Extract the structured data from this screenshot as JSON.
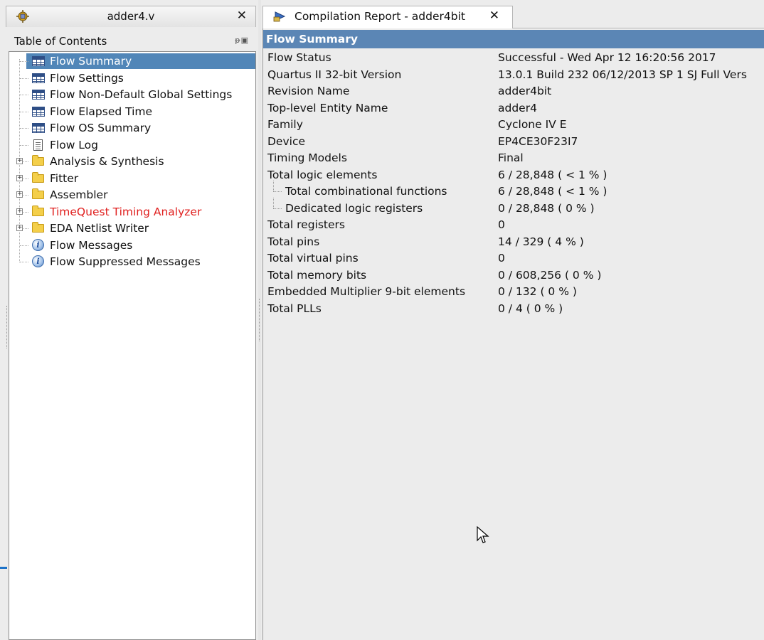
{
  "left_tab": {
    "title": "adder4.v",
    "icon": "project-chip-icon",
    "close_icon": "close-icon"
  },
  "toc": {
    "header": "Table of Contents",
    "pin_icon": "pin-icon",
    "items": [
      {
        "label": "Flow Summary",
        "icon": "table-icon",
        "selected": true
      },
      {
        "label": "Flow Settings",
        "icon": "table-icon"
      },
      {
        "label": "Flow Non-Default Global Settings",
        "icon": "table-icon"
      },
      {
        "label": "Flow Elapsed Time",
        "icon": "table-icon"
      },
      {
        "label": "Flow OS Summary",
        "icon": "table-icon"
      },
      {
        "label": "Flow Log",
        "icon": "document-icon"
      },
      {
        "label": "Analysis & Synthesis",
        "icon": "folder-icon",
        "expandable": true
      },
      {
        "label": "Fitter",
        "icon": "folder-icon",
        "expandable": true
      },
      {
        "label": "Assembler",
        "icon": "folder-icon",
        "expandable": true
      },
      {
        "label": "TimeQuest Timing Analyzer",
        "icon": "folder-icon",
        "expandable": true,
        "color": "#e0201f"
      },
      {
        "label": "EDA Netlist Writer",
        "icon": "folder-icon",
        "expandable": true
      },
      {
        "label": "Flow Messages",
        "icon": "info-icon"
      },
      {
        "label": "Flow Suppressed Messages",
        "icon": "info-icon"
      }
    ]
  },
  "right_tab": {
    "title": "Compilation Report - adder4bit",
    "icon": "compile-report-icon",
    "close_icon": "close-icon"
  },
  "report": {
    "title": "Flow Summary",
    "rows": [
      {
        "key": "Flow Status",
        "value": "Successful - Wed Apr 12 16:20:56 2017"
      },
      {
        "key": "Quartus II 32-bit Version",
        "value": "13.0.1 Build 232 06/12/2013 SP 1 SJ Full Vers"
      },
      {
        "key": "Revision Name",
        "value": "adder4bit"
      },
      {
        "key": "Top-level Entity Name",
        "value": "adder4"
      },
      {
        "key": "Family",
        "value": "Cyclone IV E"
      },
      {
        "key": "Device",
        "value": "EP4CE30F23I7"
      },
      {
        "key": "Timing Models",
        "value": "Final"
      },
      {
        "key": "Total logic elements",
        "value": "6 / 28,848 ( < 1 % )"
      },
      {
        "key": "Total combinational functions",
        "value": "6 / 28,848 ( < 1 % )",
        "sub": true
      },
      {
        "key": "Dedicated logic registers",
        "value": "0 / 28,848 ( 0 % )",
        "sub": true
      },
      {
        "key": "Total registers",
        "value": "0"
      },
      {
        "key": "Total pins",
        "value": "14 / 329 ( 4 % )"
      },
      {
        "key": "Total virtual pins",
        "value": "0"
      },
      {
        "key": "Total memory bits",
        "value": "0 / 608,256 ( 0 % )"
      },
      {
        "key": "Embedded Multiplier 9-bit elements",
        "value": "0 / 132 ( 0 % )"
      },
      {
        "key": "Total PLLs",
        "value": "0 / 4 ( 0 % )"
      }
    ]
  },
  "cursor_icon": "mouse-pointer-icon"
}
